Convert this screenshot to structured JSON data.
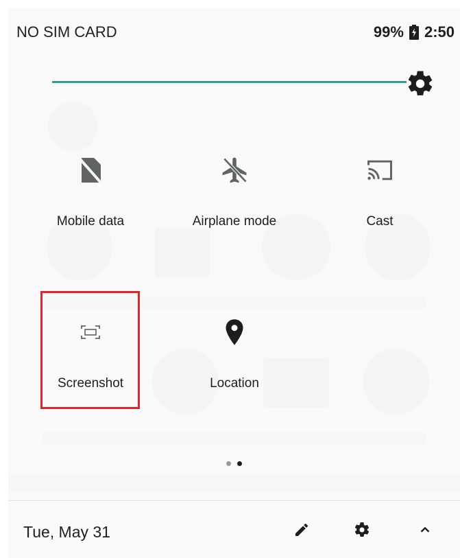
{
  "status_bar": {
    "carrier": "NO SIM CARD",
    "battery": "99%",
    "time": "2:50",
    "battery_icon": "battery-charging-icon"
  },
  "brightness": {
    "level": 0.93,
    "icon": "brightness-gear-icon"
  },
  "tiles": [
    {
      "label": "Mobile data",
      "icon": "mobile-data-off-icon"
    },
    {
      "label": "Airplane mode",
      "icon": "airplane-mode-off-icon"
    },
    {
      "label": "Cast",
      "icon": "cast-icon"
    },
    {
      "label": "Screenshot",
      "icon": "screenshot-icon",
      "highlighted": true
    },
    {
      "label": "Location",
      "icon": "location-pin-icon"
    }
  ],
  "pager": {
    "pages": 2,
    "current": 2
  },
  "footer": {
    "date": "Tue, May 31",
    "edit_icon": "pencil-icon",
    "settings_icon": "gear-icon",
    "collapse_icon": "chevron-up-icon"
  },
  "colors": {
    "accent": "#2e9c90",
    "highlight": "#e5242a",
    "text": "#1d1d1d",
    "icon_muted": "#5f6362"
  }
}
